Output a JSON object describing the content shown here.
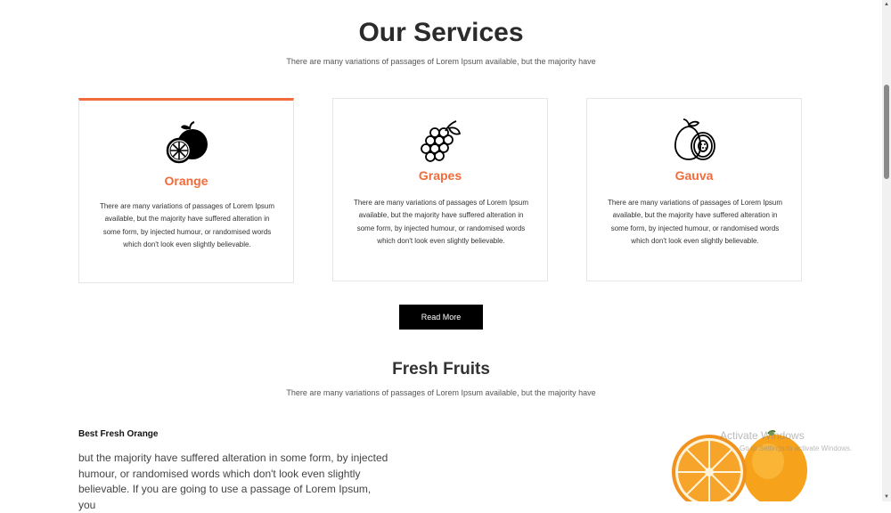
{
  "services": {
    "title": "Our Services",
    "subtitle": "There are many variations of passages of Lorem Ipsum available, but the majority have",
    "cards": [
      {
        "name": "Orange",
        "icon": "orange-icon",
        "text": "There are many variations of passages of Lorem Ipsum available, but the majority have suffered alteration in some form, by injected humour, or randomised words which don't look even slightly believable.",
        "active": true
      },
      {
        "name": "Grapes",
        "icon": "grapes-icon",
        "text": "There are many variations of passages of Lorem Ipsum available, but the majority have suffered alteration in some form, by injected humour, or randomised words which don't look even slightly believable.",
        "active": false
      },
      {
        "name": "Gauva",
        "icon": "guava-icon",
        "text": "There are many variations of passages of Lorem Ipsum available, but the majority have suffered alteration in some form, by injected humour, or randomised words which don't look even slightly believable.",
        "active": false
      }
    ],
    "read_more_label": "Read More"
  },
  "fresh": {
    "title": "Fresh Fruits",
    "subtitle": "There are many variations of passages of Lorem Ipsum available, but the majority have",
    "item_heading": "Best Fresh Orange",
    "item_body": "but the majority have suffered alteration in some form, by injected humour, or randomised words which don't look even slightly believable. If you are going to use a passage of Lorem Ipsum, you"
  },
  "watermark": {
    "line1": "Activate Windows",
    "line2": "Go to Settings to activate Windows."
  },
  "colors": {
    "accent": "#f26b3a",
    "button_bg": "#000000",
    "heading": "#2b2b2b"
  }
}
